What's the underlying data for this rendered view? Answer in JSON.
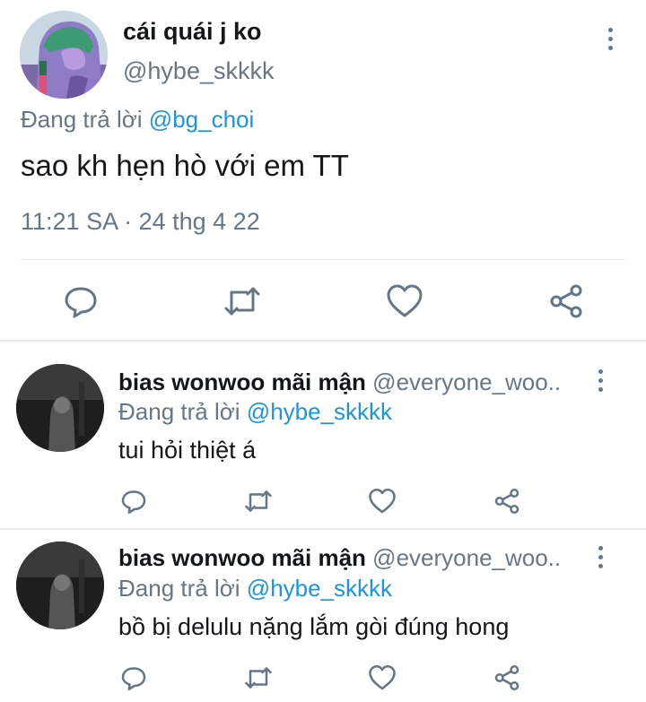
{
  "main_tweet": {
    "display_name": "cái quái j ko",
    "handle": "@hybe_skkkk",
    "reply_prefix": "Đang trả lời",
    "reply_to": "@bg_choi",
    "text": "sao kh hẹn hò với em TT",
    "timestamp": "11:21 SA · 24 thg 4 22"
  },
  "replies": [
    {
      "display_name": "bias wonwoo mãi mận",
      "handle": "@everyone_woo..",
      "reply_prefix": "Đang trả lời",
      "reply_to": "@hybe_skkkk",
      "text": "tui hỏi thiệt á"
    },
    {
      "display_name": "bias wonwoo mãi mận",
      "handle": "@everyone_woo..",
      "reply_prefix": "Đang trả lời",
      "reply_to": "@hybe_skkkk",
      "text": "bồ bị delulu nặng lắm gòi đúng hong"
    }
  ],
  "icons": {
    "reply": "speech-bubble-icon",
    "retweet": "retweet-icon",
    "like": "heart-icon",
    "share": "share-icon",
    "more": "more-vertical-icon"
  },
  "colors": {
    "mention": "#1b95e0",
    "secondary_text": "#657786",
    "icon": "#657786"
  }
}
